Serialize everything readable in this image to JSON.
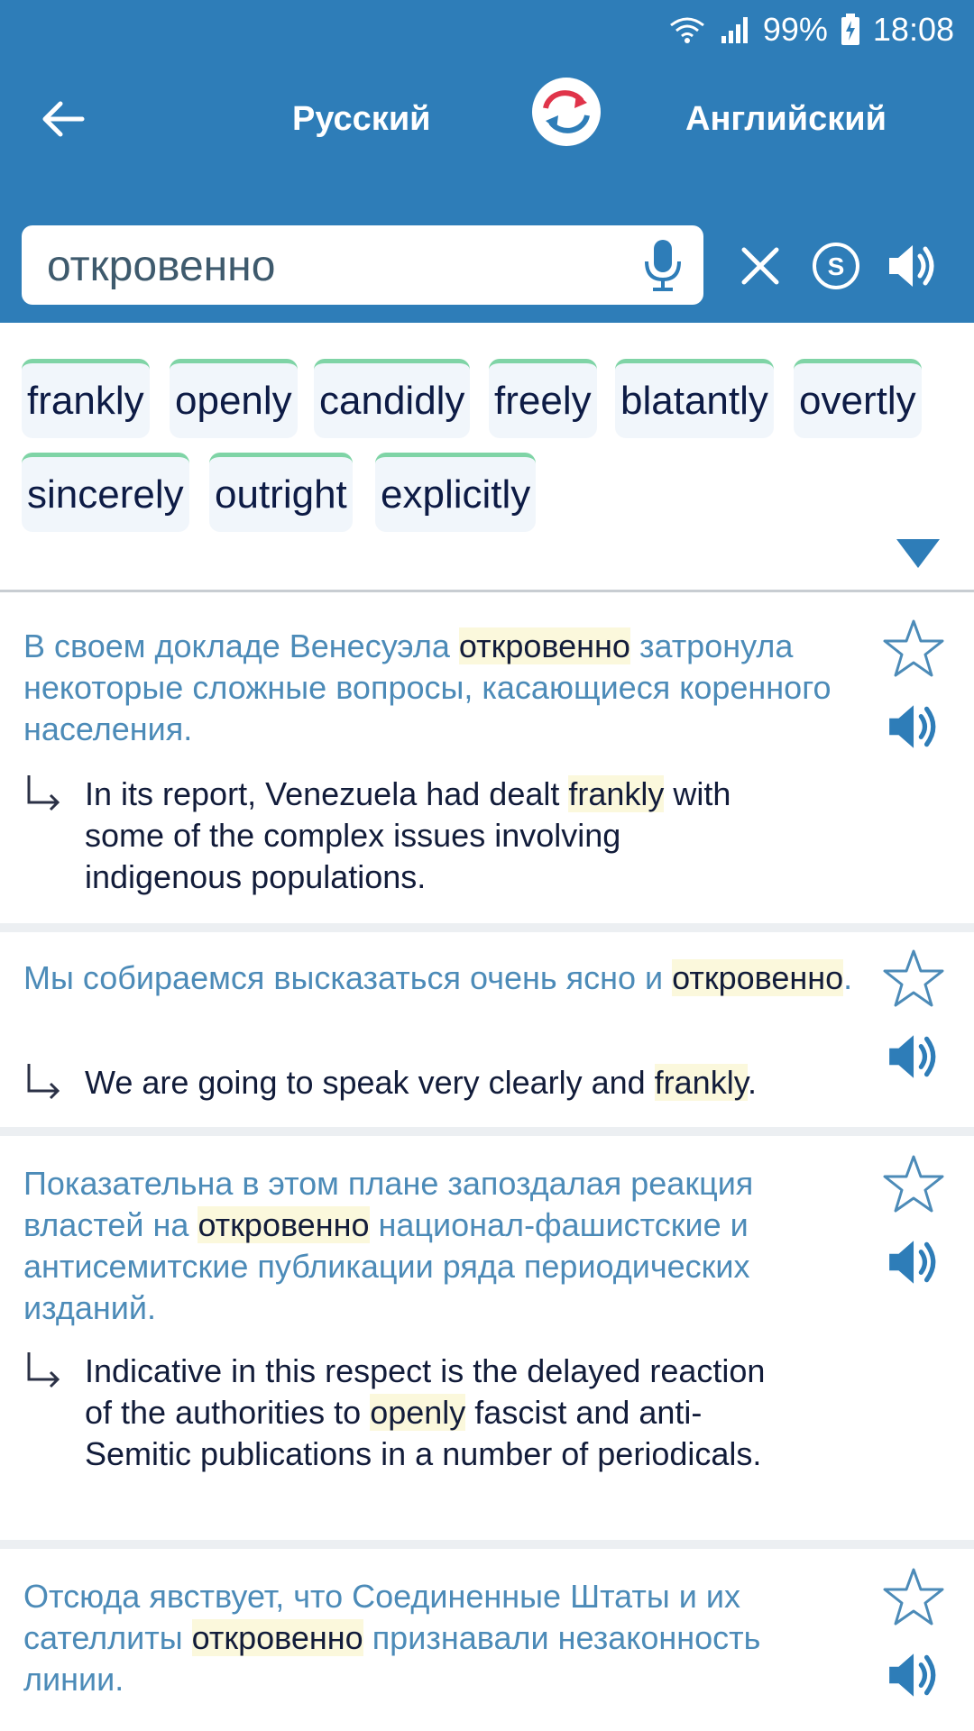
{
  "status": {
    "battery": "99%",
    "time": "18:08"
  },
  "header": {
    "lang_from": "Русский",
    "lang_to": "Английский",
    "search_value": "откровенно"
  },
  "chips": [
    "frankly",
    "openly",
    "candidly",
    "freely",
    "blatantly",
    "overtly",
    "sincerely",
    "outright",
    "explicitly"
  ],
  "examples": [
    {
      "ru": [
        {
          "t": "В своем докладе Венесуэла "
        },
        {
          "t": "откровенно",
          "h": true
        },
        {
          "t": " затронула некоторые сложные вопросы, касающиеся коренного населения."
        }
      ],
      "en": [
        {
          "t": "In its report, Venezuela had dealt "
        },
        {
          "t": "frankly",
          "h": true
        },
        {
          "t": " with some of the complex issues involving indigenous populations."
        }
      ]
    },
    {
      "ru": [
        {
          "t": "Мы собираемся высказаться очень ясно и "
        },
        {
          "t": "откровенно",
          "h": true
        },
        {
          "t": "."
        }
      ],
      "en": [
        {
          "t": "We are going to speak very clearly and "
        },
        {
          "t": "frankly",
          "h": true
        },
        {
          "t": "."
        }
      ]
    },
    {
      "ru": [
        {
          "t": "Показательна в этом плане запоздалая реакция властей на "
        },
        {
          "t": "откровенно",
          "h": true
        },
        {
          "t": " национал-фашистские и антисемитские публикации ряда периодических изданий."
        }
      ],
      "en": [
        {
          "t": "Indicative in this respect is the delayed reaction of the authorities to "
        },
        {
          "t": "openly",
          "h": true
        },
        {
          "t": " fascist and anti-Semitic publications in a number of periodicals."
        }
      ]
    },
    {
      "ru": [
        {
          "t": "Отсюда явствует, что Соединенные Штаты и их сателлиты "
        },
        {
          "t": "откровенно",
          "h": true
        },
        {
          "t": " признавали незаконность линии."
        }
      ],
      "en": []
    }
  ],
  "colors": {
    "header": "#2e7db8",
    "chip_accent": "#7fd4a6",
    "ru_text": "#4c8bb8",
    "highlight": "#fbf8dc"
  }
}
